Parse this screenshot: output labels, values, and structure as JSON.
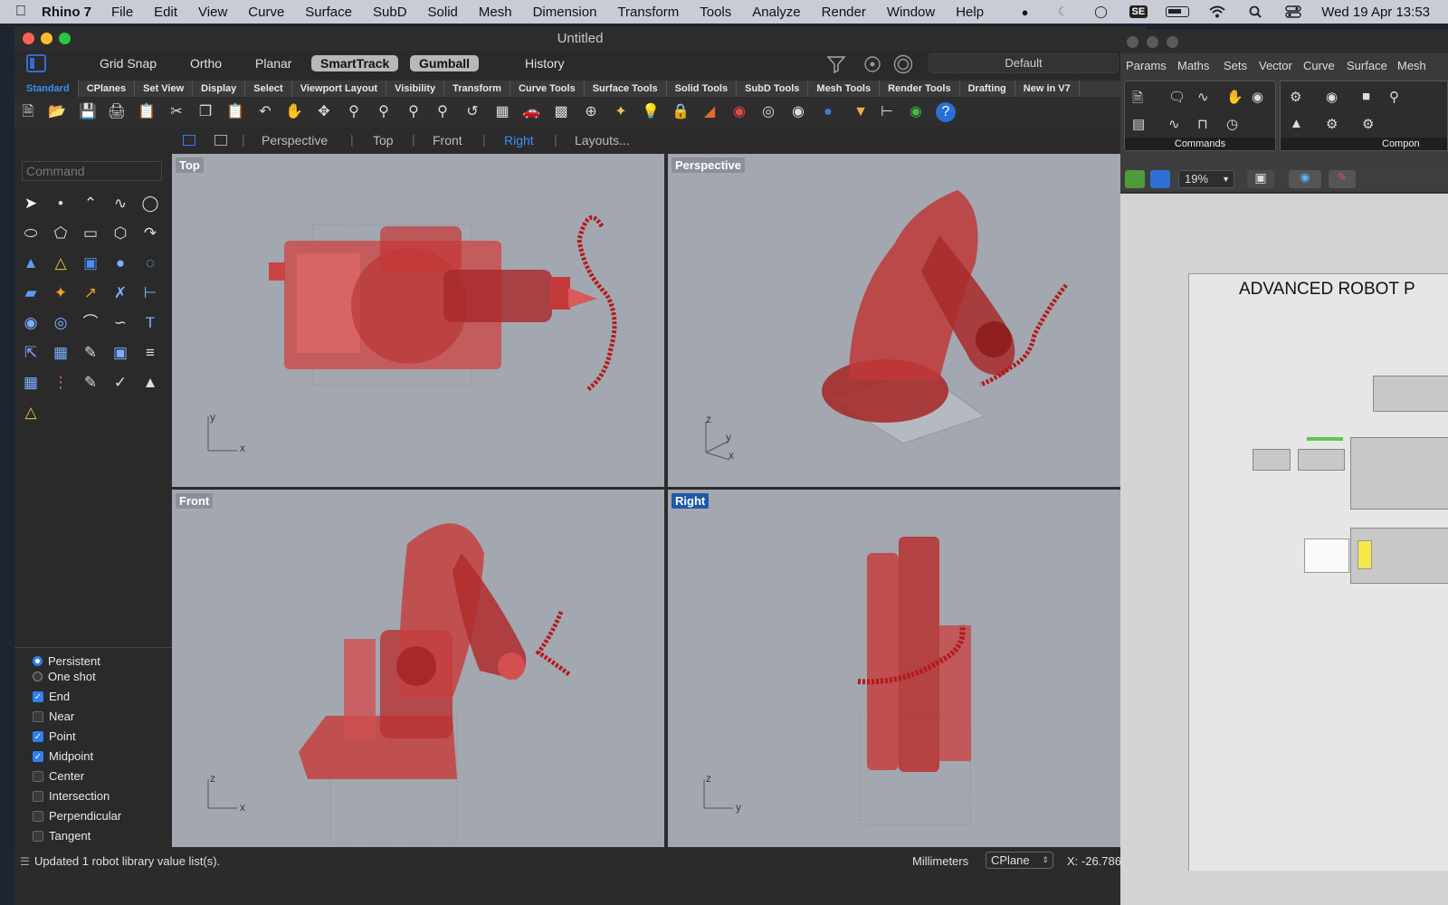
{
  "menubar": {
    "app_name": "Rhino 7",
    "items": [
      "File",
      "Edit",
      "View",
      "Curve",
      "Surface",
      "SubD",
      "Solid",
      "Mesh",
      "Dimension",
      "Transform",
      "Tools",
      "Analyze",
      "Render",
      "Window",
      "Help"
    ],
    "se_badge": "SE",
    "clock": "Wed 19 Apr  13:53"
  },
  "rhino": {
    "title": "Untitled",
    "toolbar": {
      "grid_snap": "Grid Snap",
      "ortho": "Ortho",
      "planar": "Planar",
      "smarttrack": "SmartTrack",
      "gumball": "Gumball",
      "history": "History",
      "display_mode": "Default"
    },
    "tabs": [
      "Standard",
      "CPlanes",
      "Set View",
      "Display",
      "Select",
      "Viewport Layout",
      "Visibility",
      "Transform",
      "Curve Tools",
      "Surface Tools",
      "Solid Tools",
      "SubD Tools",
      "Mesh Tools",
      "Render Tools",
      "Drafting",
      "New in V7"
    ],
    "viewport_tabs": [
      "Perspective",
      "Top",
      "Front",
      "Right",
      "Layouts..."
    ],
    "active_viewport_tab": "Right",
    "command_placeholder": "Command",
    "viewports": {
      "top": {
        "label": "Top",
        "axis_a": "y",
        "axis_b": "x"
      },
      "perspective": {
        "label": "Perspective",
        "axis_a": "z",
        "axis_b": "y",
        "axis_c": "x"
      },
      "front": {
        "label": "Front",
        "axis_a": "z",
        "axis_b": "x"
      },
      "right": {
        "label": "Right",
        "axis_a": "z",
        "axis_b": "y"
      }
    },
    "osnap": {
      "persistent": "Persistent",
      "one_shot": "One shot",
      "items": [
        {
          "label": "End",
          "checked": true
        },
        {
          "label": "Near",
          "checked": false
        },
        {
          "label": "Point",
          "checked": true
        },
        {
          "label": "Midpoint",
          "checked": true
        },
        {
          "label": "Center",
          "checked": false
        },
        {
          "label": "Intersection",
          "checked": false
        },
        {
          "label": "Perpendicular",
          "checked": false
        },
        {
          "label": "Tangent",
          "checked": false
        }
      ]
    },
    "status": {
      "message": "Updated 1 robot library value list(s).",
      "units": "Millimeters",
      "cplane": "CPlane",
      "coords": "X: -26.786"
    }
  },
  "grasshopper": {
    "menu": [
      "Params",
      "Maths",
      "Sets",
      "Vector",
      "Curve",
      "Surface",
      "Mesh"
    ],
    "panel_commands": "Commands",
    "panel_components": "Compon",
    "zoom": "19%",
    "canvas_title": "ADVANCED ROBOT P"
  }
}
